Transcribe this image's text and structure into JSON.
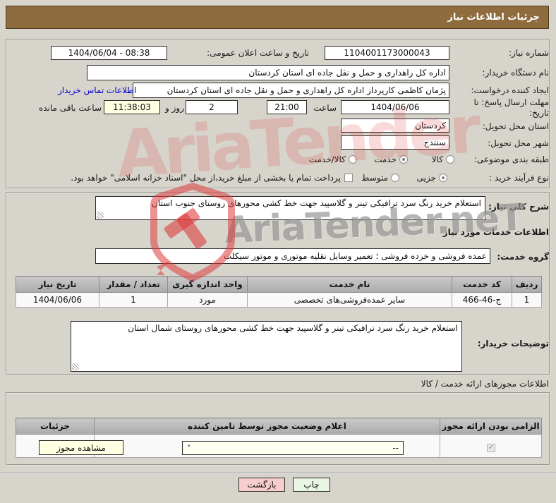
{
  "header": {
    "title": "جزئیات اطلاعات نیاز"
  },
  "info": {
    "need_number": {
      "label": "شماره نیاز:",
      "value": "1104001173000043"
    },
    "announce": {
      "label": "تاریخ و ساعت اعلان عمومی:",
      "value": "1404/06/04 - 08:38"
    },
    "buyer_org": {
      "label": "نام دستگاه خریدار:",
      "value": "اداره کل راهداری و حمل و نقل جاده ای استان کردستان"
    },
    "creator": {
      "label": "ایجاد کننده درخواست:",
      "value": "پژمان کاظمی کارپرداز اداره کل راهداری و حمل و نقل جاده ای استان کردستان",
      "contact_link": "اطلاعات تماس خریدار"
    },
    "deadline": {
      "label": "مهلت ارسال پاسخ: تا تاریخ:",
      "date": "1404/06/06",
      "hour_label": "ساعت",
      "time": "21:00",
      "days": "2",
      "days_label": "روز و",
      "remaining": "11:38:03",
      "remaining_label": "ساعت باقی مانده"
    },
    "province": {
      "label": "استان محل تحویل:",
      "value": "کردستان"
    },
    "city": {
      "label": "شهر محل تحویل:",
      "value": "سنندج"
    },
    "subject": {
      "label": "طبقه بندی موضوعی:",
      "options": [
        {
          "label": "کالا",
          "selected": false
        },
        {
          "label": "خدمت",
          "selected": true
        },
        {
          "label": "کالا/خدمت",
          "selected": false
        }
      ]
    },
    "process": {
      "label": "نوع فرآیند خرید :",
      "options": [
        {
          "label": "جزیی",
          "selected": true
        },
        {
          "label": "متوسط",
          "selected": false
        }
      ],
      "payment_checked": false,
      "payment_note": "پرداخت تمام یا بخشی از مبلغ خرید،از محل \"اسناد خزانه اسلامی\" خواهد بود."
    }
  },
  "need_desc": {
    "label": "شرح کلي نیاز:",
    "value": "استعلام خرید رنگ سرد ترافیکی تینر و گلاسپید جهت خط کشی محورهای روستای جنوب استان"
  },
  "services_section": {
    "title": "اطلاعات خدمات مورد نیاز",
    "group_label": "گروه خدمت:",
    "group_value": "عمده فروشی و خرده فروشی ؛ تعمیر وسایل نقلیه موتوری و موتور سیکلت"
  },
  "services_table": {
    "headers": [
      "ردیف",
      "کد خدمت",
      "نام خدمت",
      "واحد اندازه گیری",
      "تعداد / مقدار",
      "تاریخ نیاز"
    ],
    "rows": [
      [
        "1",
        "ج-46-466",
        "سایر عمده‌فروشی‌های تخصصی",
        "مورد",
        "1",
        "1404/06/06"
      ]
    ]
  },
  "buyer_notes": {
    "label": "توضیحات خریدار:",
    "value": "استعلام خرید رنگ سرد ترافیکی تینر و گلاسپید جهت خط کشی محورهای روستای شمال استان"
  },
  "licenses_section": {
    "title": "اطلاعات مجوزهای ارائه خدمت / کالا"
  },
  "licenses_table": {
    "headers": [
      "الزامی بودن ارائه مجوز",
      "اعلام وضعیت مجوز توسط تامین کننده",
      "جزئیات"
    ],
    "row": {
      "required_checked": true,
      "status_value": "--",
      "details_button": "مشاهده مجوز"
    }
  },
  "footer": {
    "back": "بازگشت",
    "print": "چاپ"
  },
  "watermark": {
    "text": "AriaTender.neT",
    "brand_short": "AriaTender"
  },
  "colors": {
    "header_brown": "#8e6c3e",
    "link_blue": "#0000cc",
    "field_yellow": "#ffffe1",
    "back_pink": "#f7cdcd",
    "print_green": "#e9f6e4",
    "watermark_red": "#e04646",
    "watermark_gray": "#6e6e6e",
    "table_header_gray": "#b5b5b5"
  }
}
